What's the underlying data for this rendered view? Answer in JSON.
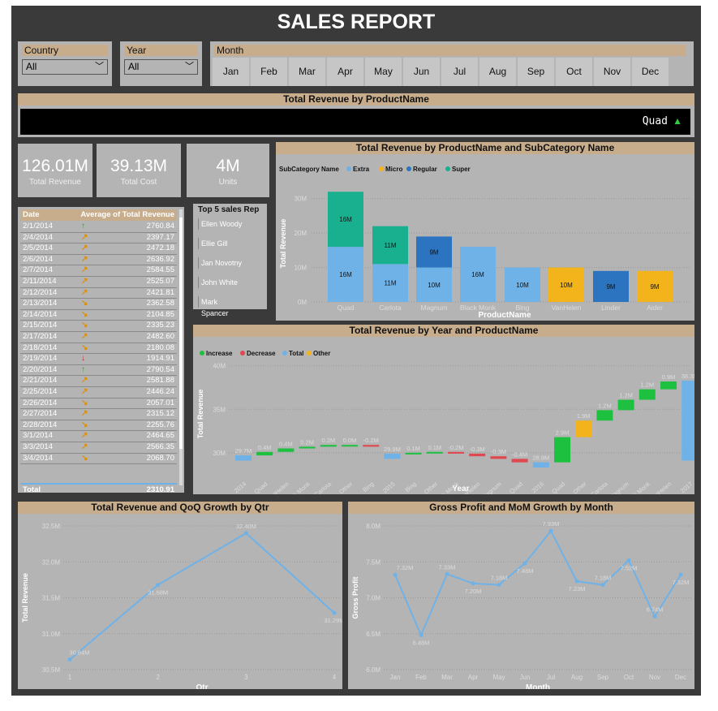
{
  "title": "SALES REPORT",
  "filters": {
    "country": {
      "label": "Country",
      "value": "All"
    },
    "year": {
      "label": "Year",
      "value": "All"
    },
    "month": {
      "label": "Month",
      "options": [
        "Jan",
        "Feb",
        "Mar",
        "Apr",
        "May",
        "Jun",
        "Jul",
        "Aug",
        "Sep",
        "Oct",
        "Nov",
        "Dec"
      ]
    }
  },
  "ticker": {
    "title": "Total Revenue by ProductName",
    "text": "Quad",
    "indicator": "▲"
  },
  "kpis": [
    {
      "value": "126.01M",
      "label": "Total Revenue"
    },
    {
      "value": "39.13M",
      "label": "Total Cost"
    },
    {
      "value": "4M",
      "label": "Units"
    }
  ],
  "colors": {
    "extra": "#6fb2e8",
    "micro": "#f2b31b",
    "regular": "#2c74c0",
    "super": "#18b08e",
    "increase": "#1ec040",
    "decrease": "#e04850",
    "total": "#6fb2e8",
    "other": "#f2b31b",
    "up": "#3a9a3a",
    "right_up": "#d98e10",
    "right_down": "#d98e10",
    "down": "#d02020"
  },
  "table": {
    "headers": [
      "Date",
      "Average of Total Revenue"
    ],
    "rows": [
      {
        "date": "2/1/2014",
        "icon": "up-arrow-icon",
        "value": "2760.84"
      },
      {
        "date": "2/4/2014",
        "icon": "up-right-arrow-icon",
        "value": "2397.17"
      },
      {
        "date": "2/5/2014",
        "icon": "up-right-arrow-icon",
        "value": "2472.18"
      },
      {
        "date": "2/6/2014",
        "icon": "up-right-arrow-icon",
        "value": "2636.92"
      },
      {
        "date": "2/7/2014",
        "icon": "up-right-arrow-icon",
        "value": "2584.55"
      },
      {
        "date": "2/11/2014",
        "icon": "up-right-arrow-icon",
        "value": "2525.07"
      },
      {
        "date": "2/12/2014",
        "icon": "up-right-arrow-icon",
        "value": "2421.81"
      },
      {
        "date": "2/13/2014",
        "icon": "down-right-arrow-icon",
        "value": "2362.58"
      },
      {
        "date": "2/14/2014",
        "icon": "down-right-arrow-icon",
        "value": "2104.85"
      },
      {
        "date": "2/15/2014",
        "icon": "down-right-arrow-icon",
        "value": "2335.23"
      },
      {
        "date": "2/17/2014",
        "icon": "up-right-arrow-icon",
        "value": "2482.60"
      },
      {
        "date": "2/18/2014",
        "icon": "down-right-arrow-icon",
        "value": "2180.08"
      },
      {
        "date": "2/19/2014",
        "icon": "down-arrow-icon",
        "value": "1914.91"
      },
      {
        "date": "2/20/2014",
        "icon": "up-arrow-icon",
        "value": "2790.54"
      },
      {
        "date": "2/21/2014",
        "icon": "up-right-arrow-icon",
        "value": "2581.88"
      },
      {
        "date": "2/25/2014",
        "icon": "up-right-arrow-icon",
        "value": "2446.24"
      },
      {
        "date": "2/26/2014",
        "icon": "down-right-arrow-icon",
        "value": "2057.01"
      },
      {
        "date": "2/27/2014",
        "icon": "up-right-arrow-icon",
        "value": "2315.12"
      },
      {
        "date": "2/28/2014",
        "icon": "down-right-arrow-icon",
        "value": "2255.76"
      },
      {
        "date": "3/1/2014",
        "icon": "up-right-arrow-icon",
        "value": "2464.65"
      },
      {
        "date": "3/3/2014",
        "icon": "up-right-arrow-icon",
        "value": "2566.35"
      },
      {
        "date": "3/4/2014",
        "icon": "down-right-arrow-icon",
        "value": "2068.70"
      }
    ],
    "total_label": "Total",
    "total_value": "2310.91"
  },
  "reps": {
    "title": "Top 5 sales Rep",
    "names": [
      "Ellen Woody",
      "Ellie Gill",
      "Jan Novotny",
      "John White",
      "Mark Spancer"
    ]
  },
  "chart_data": [
    {
      "type": "bar",
      "title": "Total Revenue by ProductName and SubCategory Name",
      "legend_title": "SubCategory Name",
      "legend": [
        "Extra",
        "Micro",
        "Regular",
        "Super"
      ],
      "xlabel": "ProductName",
      "ylabel": "Total Revenue",
      "yticks": [
        "0M",
        "10M",
        "20M",
        "30M"
      ],
      "ylim": [
        0,
        33
      ],
      "categories": [
        "Quad",
        "Carlota",
        "Magnum",
        "Black Monk",
        "Bing",
        "VanHelen",
        "Linder",
        "Aider"
      ],
      "series": [
        {
          "name": "Extra",
          "values": [
            16,
            11,
            10,
            16,
            10,
            0,
            0,
            0
          ],
          "labels": [
            "16M",
            "11M",
            "10M",
            "16M",
            "10M",
            "",
            "",
            ""
          ]
        },
        {
          "name": "Micro",
          "values": [
            0,
            0,
            0,
            0,
            0,
            10,
            0,
            9
          ],
          "labels": [
            "",
            "",
            "",
            "",
            "",
            "10M",
            "",
            "9M"
          ]
        },
        {
          "name": "Regular",
          "values": [
            0,
            0,
            9,
            0,
            0,
            0,
            9,
            0
          ],
          "labels": [
            "",
            "",
            "9M",
            "",
            "",
            "",
            "9M",
            ""
          ]
        },
        {
          "name": "Super",
          "values": [
            16,
            11,
            0,
            0,
            0,
            0,
            0,
            0
          ],
          "labels": [
            "16M",
            "11M",
            "",
            "",
            "",
            "",
            "",
            ""
          ]
        }
      ]
    },
    {
      "type": "bar",
      "title": "Total Revenue by Year and ProductName",
      "legend": [
        "Increase",
        "Decrease",
        "Total",
        "Other"
      ],
      "xlabel": "Year",
      "ylabel": "Total Revenue",
      "yticks": [
        "30M",
        "35M",
        "40M"
      ],
      "ylim": [
        27,
        41
      ],
      "categories": [
        "2014",
        "Quad",
        "VanHelen",
        "Black Monk",
        "Carlota",
        "Other",
        "Bing",
        "2015",
        "Bing",
        "Other",
        "Black Monk",
        "VanHelen",
        "Magnum",
        "Quad",
        "2016",
        "Quad",
        "Other",
        "Carlota",
        "Magnum",
        "Black Monk",
        "VanHelen",
        "2017"
      ],
      "kind": [
        "total",
        "increase",
        "increase",
        "increase",
        "increase",
        "increase",
        "decrease",
        "total",
        "increase",
        "increase",
        "decrease",
        "decrease",
        "decrease",
        "decrease",
        "total",
        "increase",
        "other",
        "increase",
        "increase",
        "increase",
        "increase",
        "total"
      ],
      "values": [
        29.7,
        0.4,
        0.4,
        0.2,
        0.2,
        0.0,
        -0.2,
        29.9,
        0.1,
        0.1,
        -0.2,
        -0.3,
        -0.3,
        -0.4,
        28.9,
        2.9,
        1.9,
        1.2,
        1.2,
        1.2,
        0.9,
        38.3
      ],
      "labels": [
        "29.7M",
        "0.4M",
        "0.4M",
        "0.2M",
        "0.2M",
        "0.0M",
        "-0.2M",
        "29.9M",
        "0.1M",
        "0.1M",
        "-0.2M",
        "-0.3M",
        "-0.3M",
        "-0.4M",
        "28.9M",
        "2.9M",
        "1.9M",
        "1.2M",
        "1.2M",
        "1.2M",
        "0.9M",
        "38.3M"
      ]
    },
    {
      "type": "line",
      "title": "Total Revenue and QoQ Growth by Qtr",
      "xlabel": "Qtr",
      "ylabel": "Total Revenue",
      "x": [
        "1",
        "2",
        "3",
        "4"
      ],
      "values": [
        30.64,
        31.68,
        32.4,
        31.29
      ],
      "labels": [
        "30.64M",
        "31.68M",
        "32.40M",
        "31.29M"
      ],
      "yticks": [
        "30.5M",
        "31.0M",
        "31.5M",
        "32.0M",
        "32.5M"
      ],
      "ylim": [
        30.5,
        32.5
      ]
    },
    {
      "type": "line",
      "title": "Gross Profit and MoM Growth by Month",
      "xlabel": "Month",
      "ylabel": "Gross Profit",
      "x": [
        "Jan",
        "Feb",
        "Mar",
        "Apr",
        "May",
        "Jun",
        "Jul",
        "Aug",
        "Sep",
        "Oct",
        "Nov",
        "Dec"
      ],
      "values": [
        7.32,
        6.48,
        7.33,
        7.2,
        7.18,
        7.48,
        7.93,
        7.23,
        7.18,
        7.52,
        6.74,
        7.32
      ],
      "labels": [
        "7.32M",
        "6.48M",
        "7.33M",
        "7.20M",
        "7.18M",
        "7.48M",
        "7.93M",
        "7.23M",
        "7.18M",
        "7.52M",
        "6.74M",
        "7.32M"
      ],
      "yticks": [
        "6.0M",
        "6.5M",
        "7.0M",
        "7.5M",
        "8.0M"
      ],
      "ylim": [
        6.0,
        8.0
      ]
    }
  ]
}
